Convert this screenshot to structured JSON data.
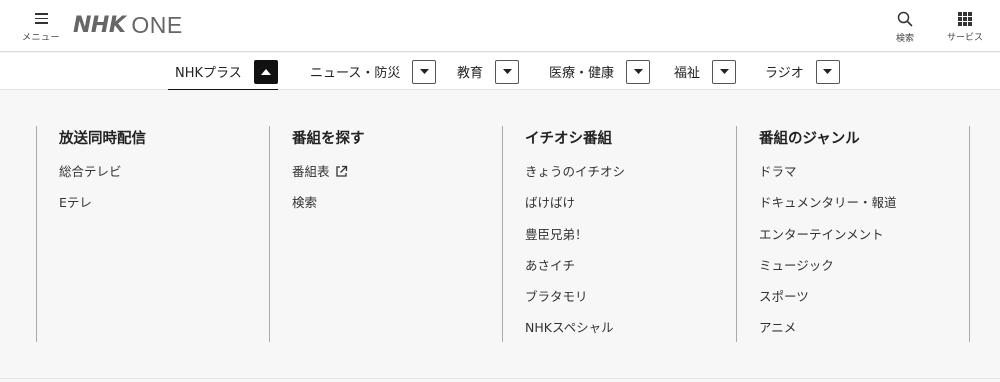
{
  "header": {
    "menu_label": "メニュー",
    "logo_nhk": "NHK",
    "logo_one": "ONE",
    "search_label": "検索",
    "services_label": "サービス"
  },
  "tabs": [
    {
      "label": "NHKプラス",
      "active": true
    },
    {
      "label": "ニュース・防災",
      "active": false
    },
    {
      "label": "教育",
      "active": false
    },
    {
      "label": "医療・健康",
      "active": false
    },
    {
      "label": "福祉",
      "active": false
    },
    {
      "label": "ラジオ",
      "active": false
    }
  ],
  "menu": {
    "columns": [
      {
        "title": "放送同時配信",
        "items": [
          "総合テレビ",
          "Eテレ"
        ]
      },
      {
        "title": "番組を探す",
        "items": [
          "番組表",
          "検索"
        ]
      },
      {
        "title": "イチオシ番組",
        "items": [
          "きょうのイチオシ",
          "ばけばけ",
          "豊臣兄弟！",
          "あさイチ",
          "ブラタモリ",
          "NHKスペシャル"
        ]
      },
      {
        "title": "番組のジャンル",
        "items": [
          "ドラマ",
          "ドキュメンタリー・報道",
          "エンターテインメント",
          "ミュージック",
          "スポーツ",
          "アニメ"
        ]
      }
    ]
  },
  "icons": {
    "menu": "hamburger-icon",
    "search": "search-icon",
    "services": "grid-icon",
    "toggle_open": "caret-up-icon",
    "toggle_closed": "caret-down-icon",
    "external": "external-link-icon"
  }
}
